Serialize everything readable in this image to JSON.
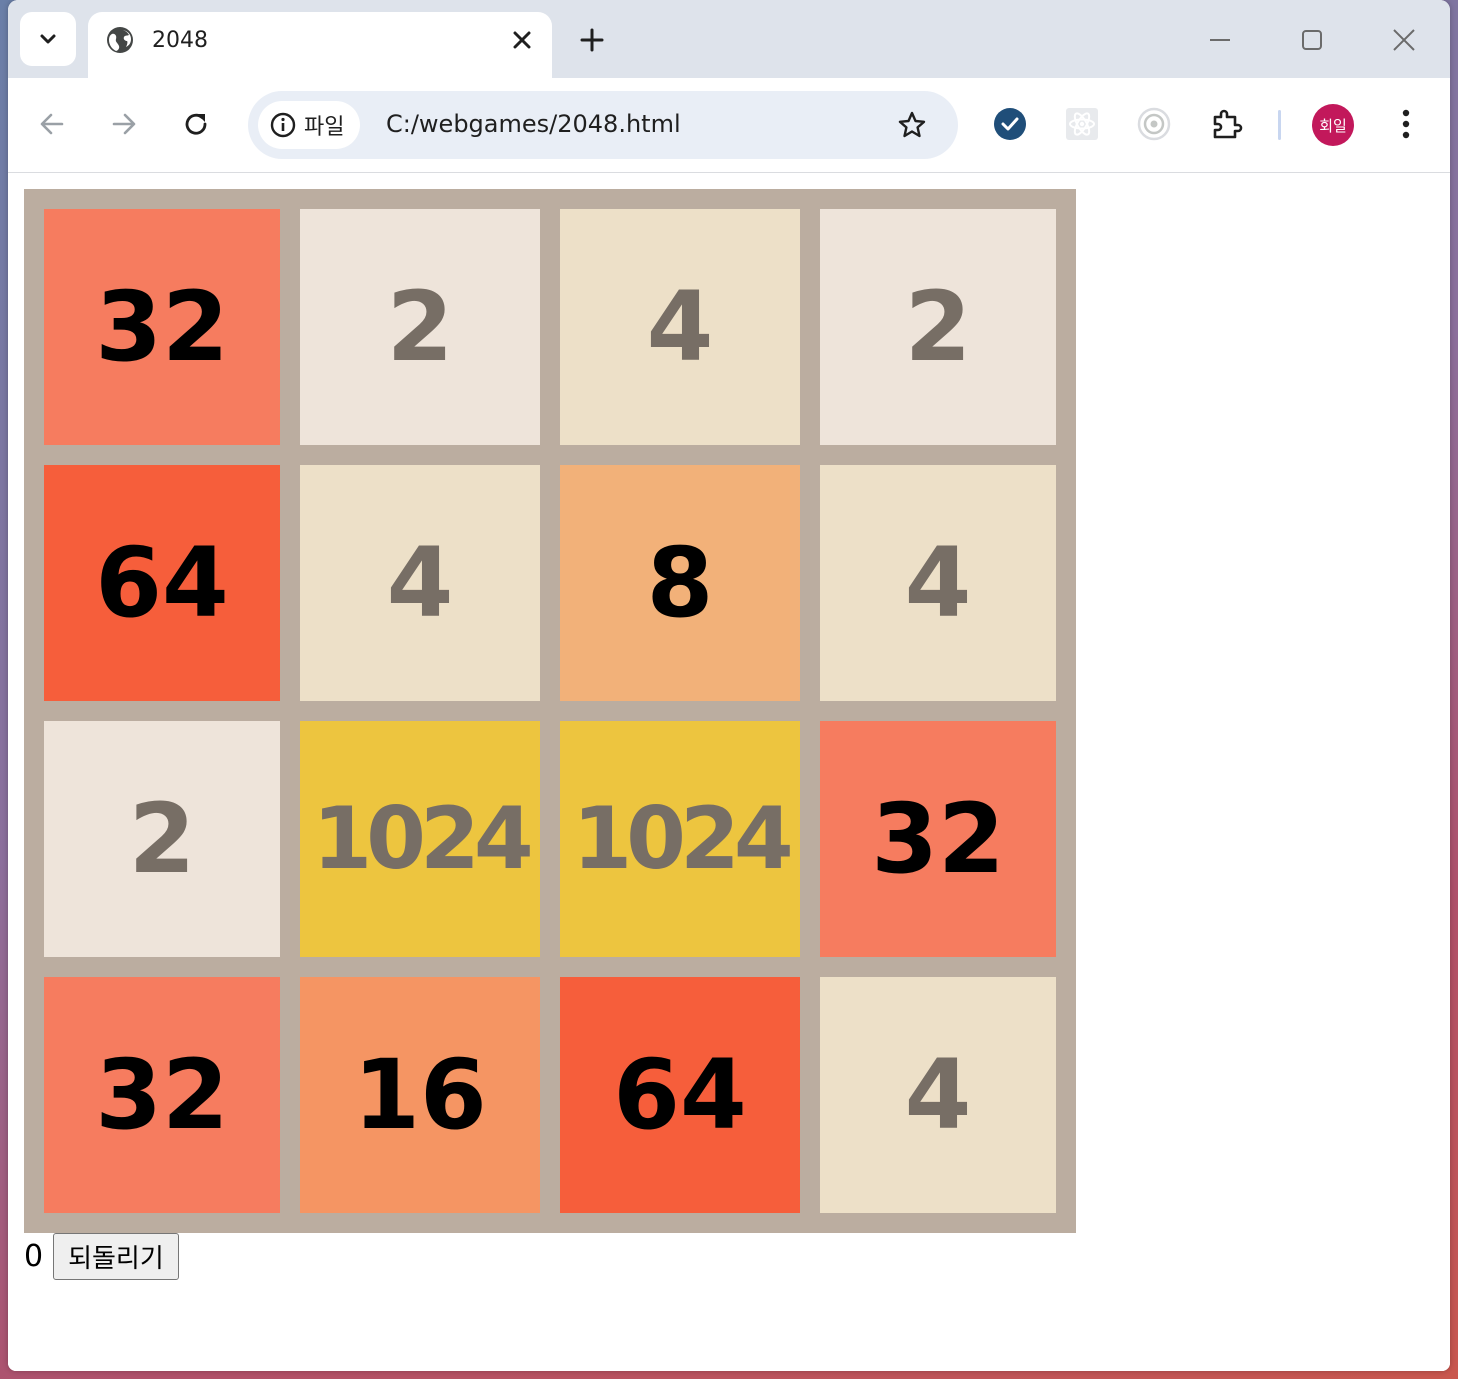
{
  "browser": {
    "tab": {
      "title": "2048"
    },
    "address": {
      "chip_label": "파일",
      "url": "C:/webgames/2048.html"
    },
    "profile": {
      "initials": "회일"
    }
  },
  "game": {
    "colors": {
      "board": "#bbada0",
      "2": "#eee4da",
      "4": "#ede0c8",
      "8": "#f2b179",
      "16": "#f59563",
      "32": "#f67c5f",
      "64": "#f65e3b",
      "1024": "#edc53f",
      "dark_text": "#776e65",
      "light_text": "#000000"
    },
    "tiles": [
      [
        "32",
        "2",
        "4",
        "2"
      ],
      [
        "64",
        "4",
        "8",
        "4"
      ],
      [
        "2",
        "1024",
        "1024",
        "32"
      ],
      [
        "32",
        "16",
        "64",
        "4"
      ]
    ],
    "score": "0",
    "undo_label": "되돌리기"
  }
}
